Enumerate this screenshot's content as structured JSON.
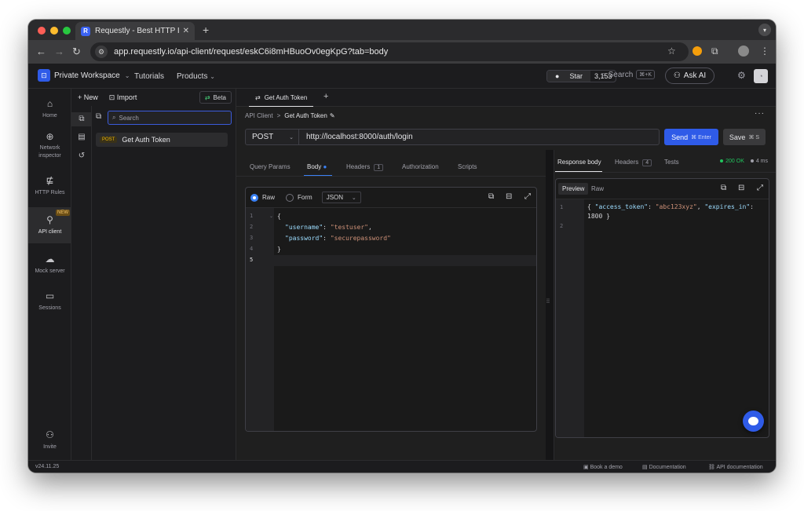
{
  "browser": {
    "tab_title": "Requestly - Best HTTP Interc",
    "tab_close": "✕",
    "new_tab": "+",
    "url": "app.requestly.io/api-client/request/eskC6i8mHBuoOv0egKpG?tab=body"
  },
  "header": {
    "workspace": "Private Workspace",
    "tutorials": "Tutorials",
    "products": "Products",
    "star_label": "Star",
    "star_count": "3,153",
    "search_label": "Search",
    "search_kbd": "⌘+K",
    "ask_ai": "Ask AI"
  },
  "rail": {
    "items": [
      {
        "label": "Home"
      },
      {
        "label": "Network inspector"
      },
      {
        "label": "HTTP Rules"
      },
      {
        "label": "API client",
        "badge": "NEW"
      },
      {
        "label": "Mock server"
      },
      {
        "label": "Sessions"
      },
      {
        "label": "Invite"
      }
    ]
  },
  "explorer": {
    "new_label": "New",
    "import_label": "Import",
    "beta_label": "Beta",
    "search_placeholder": "Search",
    "request_method": "POST",
    "request_name": "Get Auth Token"
  },
  "request": {
    "tab_label": "Get Auth Token",
    "tab_plus": "+",
    "breadcrumb_root": "API Client",
    "breadcrumb_sep": ">",
    "breadcrumb_current": "Get Auth Token",
    "more": "···",
    "method": "POST",
    "url": "http://localhost:8000/auth/login",
    "send_label": "Send",
    "send_kbd": "⌘ Enter",
    "save_label": "Save",
    "save_kbd": "⌘ S",
    "tabs": {
      "query": "Query Params",
      "body": "Body",
      "headers": "Headers",
      "headers_count": "1",
      "authorization": "Authorization",
      "scripts": "Scripts"
    },
    "body_modes": {
      "raw": "Raw",
      "form": "Form",
      "format": "JSON"
    },
    "line_numbers": [
      "1",
      "2",
      "3",
      "4",
      "5"
    ],
    "code_lines": {
      "l1": "{",
      "k2": "\"username\"",
      "v2": "\"testuser\"",
      "k3": "\"password\"",
      "v3": "\"securepassword\"",
      "l4": "}"
    }
  },
  "response": {
    "tabs": {
      "body": "Response body",
      "headers": "Headers",
      "headers_count": "4",
      "tests": "Tests"
    },
    "status": "200 OK",
    "time": "4 ms",
    "status_color": "#22c55e",
    "preview_label": "Preview",
    "raw_label": "Raw",
    "line_numbers": [
      "1",
      "2"
    ],
    "code": {
      "open": "{ ",
      "k1": "\"access_token\"",
      "v1": "\"abc123xyz\"",
      "k2": "\"expires_in\"",
      "line2": "1800 }"
    }
  },
  "footer": {
    "version": "v24.11.25",
    "book_demo": "Book a demo",
    "documentation": "Documentation",
    "api_docs": "API documentation"
  },
  "colors": {
    "accent": "#2f5be8",
    "bg": "#1f1f1f"
  }
}
